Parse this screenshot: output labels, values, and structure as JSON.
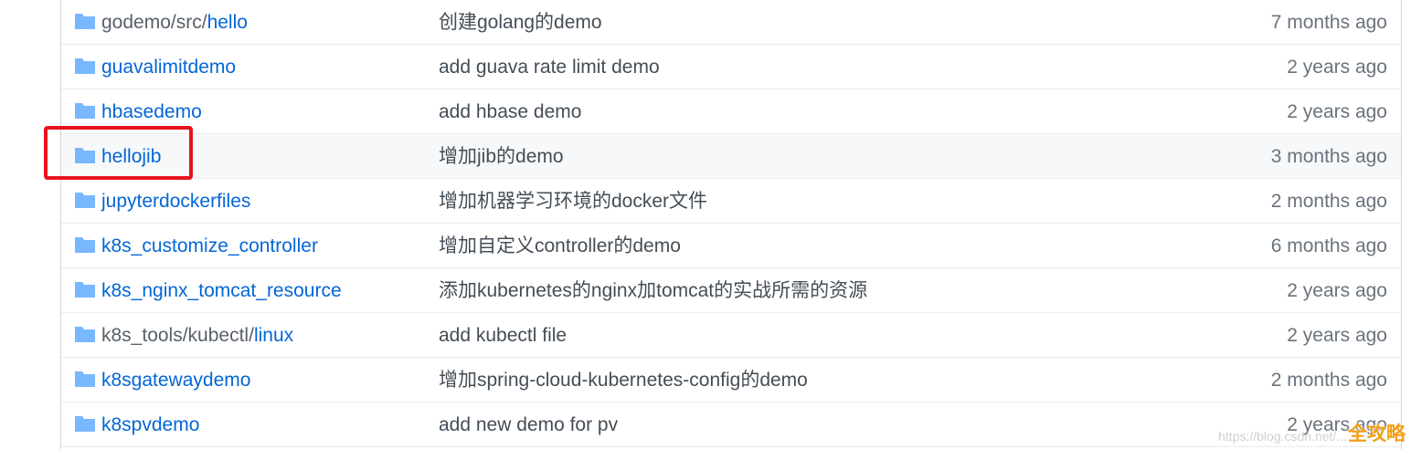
{
  "colors": {
    "link": "#0366d6",
    "path_prefix": "#586069",
    "message": "#444d56",
    "age": "#6a737d",
    "folder_icon": "#79b8ff",
    "highlight_box": "#e8131c",
    "row_hover_bg": "#f6f8fa"
  },
  "icons": {
    "folder": "folder-icon"
  },
  "rows": [
    {
      "prefix": "godemo/src/",
      "name": "hello",
      "message": "创建golang的demo",
      "age": "7 months ago"
    },
    {
      "prefix": "",
      "name": "guavalimitdemo",
      "message": "add guava rate limit demo",
      "age": "2 years ago"
    },
    {
      "prefix": "",
      "name": "hbasedemo",
      "message": "add hbase demo",
      "age": "2 years ago"
    },
    {
      "prefix": "",
      "name": "hellojib",
      "message": "增加jib的demo",
      "age": "3 months ago"
    },
    {
      "prefix": "",
      "name": "jupyterdockerfiles",
      "message": "增加机器学习环境的docker文件",
      "age": "2 months ago"
    },
    {
      "prefix": "",
      "name": "k8s_customize_controller",
      "message": "增加自定义controller的demo",
      "age": "6 months ago"
    },
    {
      "prefix": "",
      "name": "k8s_nginx_tomcat_resource",
      "message": "添加kubernetes的nginx加tomcat的实战所需的资源",
      "age": "2 years ago"
    },
    {
      "prefix": "k8s_tools/kubectl/",
      "name": "linux",
      "message": "add kubectl file",
      "age": "2 years ago"
    },
    {
      "prefix": "",
      "name": "k8sgatewaydemo",
      "message": "增加spring-cloud-kubernetes-config的demo",
      "age": "2 months ago"
    },
    {
      "prefix": "",
      "name": "k8spvdemo",
      "message": "add new demo for pv",
      "age": "2 years ago"
    }
  ],
  "highlighted_row": "hellojib",
  "watermark": {
    "url": "https://blog.csdn.net/...",
    "logo": "全攻略"
  }
}
